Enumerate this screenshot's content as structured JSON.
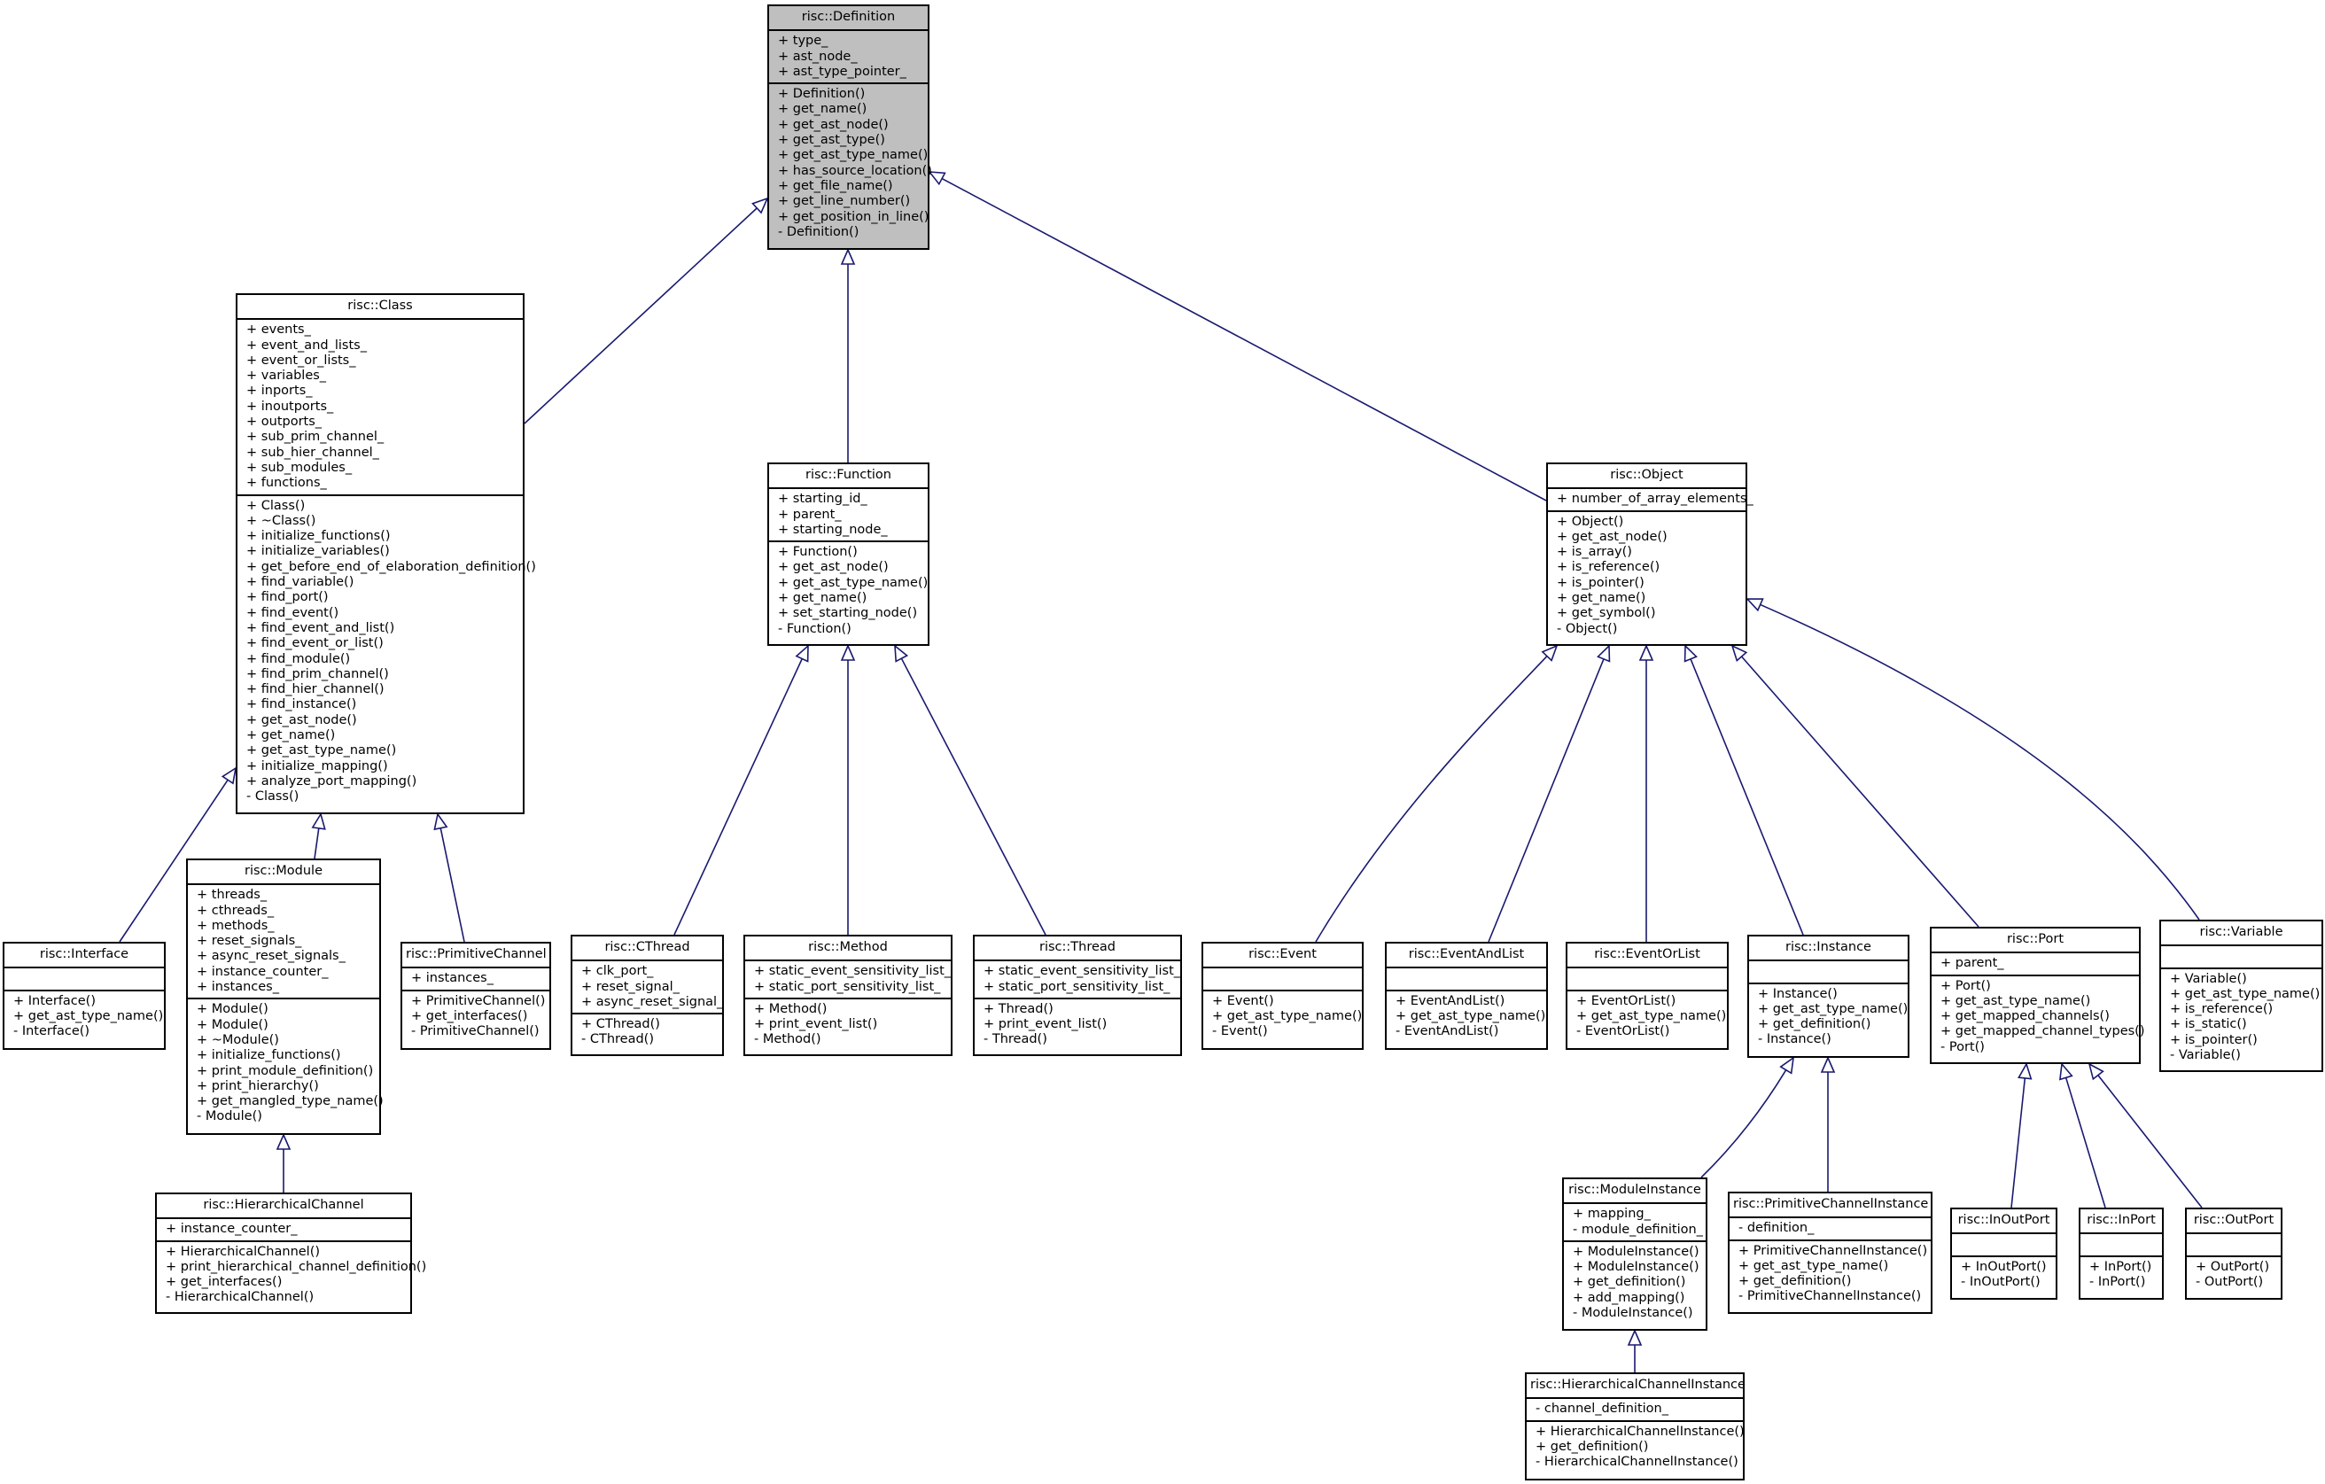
{
  "diagram": {
    "type": "uml-class-inheritance",
    "edge_color": "#191970",
    "root_fill": "#bfbfbf",
    "classes": [
      {
        "id": "Definition",
        "name": "risc::Definition",
        "root": true,
        "attributes": [
          "+ type_",
          "+ ast_node_",
          "+ ast_type_pointer_"
        ],
        "methods": [
          "+ Definition()",
          "+ get_name()",
          "+ get_ast_node()",
          "+ get_ast_type()",
          "+ get_ast_type_name()",
          "+ has_source_location()",
          "+ get_file_name()",
          "+ get_line_number()",
          "+ get_position_in_line()",
          "- Definition()"
        ]
      },
      {
        "id": "Class",
        "name": "risc::Class",
        "attributes": [
          "+ events_",
          "+ event_and_lists_",
          "+ event_or_lists_",
          "+ variables_",
          "+ inports_",
          "+ inoutports_",
          "+ outports_",
          "+ sub_prim_channel_",
          "+ sub_hier_channel_",
          "+ sub_modules_",
          "+ functions_"
        ],
        "methods": [
          "+ Class()",
          "+ ~Class()",
          "+ initialize_functions()",
          "+ initialize_variables()",
          "+ get_before_end_of_elaboration_definition()",
          "+ find_variable()",
          "+ find_port()",
          "+ find_event()",
          "+ find_event_and_list()",
          "+ find_event_or_list()",
          "+ find_module()",
          "+ find_prim_channel()",
          "+ find_hier_channel()",
          "+ find_instance()",
          "+ get_ast_node()",
          "+ get_name()",
          "+ get_ast_type_name()",
          "+ initialize_mapping()",
          "+ analyze_port_mapping()",
          "- Class()"
        ]
      },
      {
        "id": "Function",
        "name": "risc::Function",
        "attributes": [
          "+ starting_id_",
          "+ parent_",
          "+ starting_node_"
        ],
        "methods": [
          "+ Function()",
          "+ get_ast_node()",
          "+ get_ast_type_name()",
          "+ get_name()",
          "+ set_starting_node()",
          "- Function()"
        ]
      },
      {
        "id": "Object",
        "name": "risc::Object",
        "attributes": [
          "+ number_of_array_elements_"
        ],
        "methods": [
          "+ Object()",
          "+ get_ast_node()",
          "+ is_array()",
          "+ is_reference()",
          "+ is_pointer()",
          "+ get_name()",
          "+ get_symbol()",
          "- Object()"
        ]
      },
      {
        "id": "Interface",
        "name": "risc::Interface",
        "attributes": [],
        "methods": [
          "+ Interface()",
          "+ get_ast_type_name()",
          "- Interface()"
        ]
      },
      {
        "id": "Module",
        "name": "risc::Module",
        "attributes": [
          "+ threads_",
          "+ cthreads_",
          "+ methods_",
          "+ reset_signals_",
          "+ async_reset_signals_",
          "+ instance_counter_",
          "+ instances_"
        ],
        "methods": [
          "+ Module()",
          "+ Module()",
          "+ ~Module()",
          "+ initialize_functions()",
          "+ print_module_definition()",
          "+ print_hierarchy()",
          "+ get_mangled_type_name()",
          "- Module()"
        ]
      },
      {
        "id": "PrimitiveChannel",
        "name": "risc::PrimitiveChannel",
        "attributes": [
          "+ instances_"
        ],
        "methods": [
          "+ PrimitiveChannel()",
          "+ get_interfaces()",
          "- PrimitiveChannel()"
        ]
      },
      {
        "id": "HierarchicalChannel",
        "name": "risc::HierarchicalChannel",
        "attributes": [
          "+ instance_counter_"
        ],
        "methods": [
          "+ HierarchicalChannel()",
          "+ print_hierarchical_channel_definition()",
          "+ get_interfaces()",
          "- HierarchicalChannel()"
        ]
      },
      {
        "id": "CThread",
        "name": "risc::CThread",
        "attributes": [
          "+ clk_port_",
          "+ reset_signal_",
          "+ async_reset_signal_"
        ],
        "methods": [
          "+ CThread()",
          "- CThread()"
        ]
      },
      {
        "id": "Method",
        "name": "risc::Method",
        "attributes": [
          "+ static_event_sensitivity_list_",
          "+ static_port_sensitivity_list_"
        ],
        "methods": [
          "+ Method()",
          "+ print_event_list()",
          "- Method()"
        ]
      },
      {
        "id": "Thread",
        "name": "risc::Thread",
        "attributes": [
          "+ static_event_sensitivity_list_",
          "+ static_port_sensitivity_list_"
        ],
        "methods": [
          "+ Thread()",
          "+ print_event_list()",
          "- Thread()"
        ]
      },
      {
        "id": "Event",
        "name": "risc::Event",
        "attributes": [],
        "methods": [
          "+ Event()",
          "+ get_ast_type_name()",
          "- Event()"
        ]
      },
      {
        "id": "EventAndList",
        "name": "risc::EventAndList",
        "attributes": [],
        "methods": [
          "+ EventAndList()",
          "+ get_ast_type_name()",
          "- EventAndList()"
        ]
      },
      {
        "id": "EventOrList",
        "name": "risc::EventOrList",
        "attributes": [],
        "methods": [
          "+ EventOrList()",
          "+ get_ast_type_name()",
          "- EventOrList()"
        ]
      },
      {
        "id": "Instance",
        "name": "risc::Instance",
        "attributes": [],
        "methods": [
          "+ Instance()",
          "+ get_ast_type_name()",
          "+ get_definition()",
          "- Instance()"
        ]
      },
      {
        "id": "Port",
        "name": "risc::Port",
        "attributes": [
          "+ parent_"
        ],
        "methods": [
          "+ Port()",
          "+ get_ast_type_name()",
          "+ get_mapped_channels()",
          "+ get_mapped_channel_types()",
          "- Port()"
        ]
      },
      {
        "id": "Variable",
        "name": "risc::Variable",
        "attributes": [],
        "methods": [
          "+ Variable()",
          "+ get_ast_type_name()",
          "+ is_reference()",
          "+ is_static()",
          "+ is_pointer()",
          "- Variable()"
        ]
      },
      {
        "id": "ModuleInstance",
        "name": "risc::ModuleInstance",
        "attributes": [
          "+ mapping_",
          "- module_definition_"
        ],
        "methods": [
          "+ ModuleInstance()",
          "+ ModuleInstance()",
          "+ get_definition()",
          "+ add_mapping()",
          "- ModuleInstance()"
        ]
      },
      {
        "id": "PrimitiveChannelInstance",
        "name": "risc::PrimitiveChannelInstance",
        "attributes": [
          "- definition_"
        ],
        "methods": [
          "+ PrimitiveChannelInstance()",
          "+ get_ast_type_name()",
          "+ get_definition()",
          "- PrimitiveChannelInstance()"
        ]
      },
      {
        "id": "InOutPort",
        "name": "risc::InOutPort",
        "attributes": [],
        "methods": [
          "+ InOutPort()",
          "- InOutPort()"
        ]
      },
      {
        "id": "InPort",
        "name": "risc::InPort",
        "attributes": [],
        "methods": [
          "+ InPort()",
          "- InPort()"
        ]
      },
      {
        "id": "OutPort",
        "name": "risc::OutPort",
        "attributes": [],
        "methods": [
          "+ OutPort()",
          "- OutPort()"
        ]
      },
      {
        "id": "HierarchicalChannelInstance",
        "name": "risc::HierarchicalChannelInstance",
        "attributes": [
          "- channel_definition_"
        ],
        "methods": [
          "+ HierarchicalChannelInstance()",
          "+ get_definition()",
          "- HierarchicalChannelInstance()"
        ]
      }
    ],
    "inheritance": [
      {
        "child": "Class",
        "parent": "Definition"
      },
      {
        "child": "Function",
        "parent": "Definition"
      },
      {
        "child": "Object",
        "parent": "Definition"
      },
      {
        "child": "Interface",
        "parent": "Class"
      },
      {
        "child": "Module",
        "parent": "Class"
      },
      {
        "child": "PrimitiveChannel",
        "parent": "Class"
      },
      {
        "child": "HierarchicalChannel",
        "parent": "Module"
      },
      {
        "child": "CThread",
        "parent": "Function"
      },
      {
        "child": "Method",
        "parent": "Function"
      },
      {
        "child": "Thread",
        "parent": "Function"
      },
      {
        "child": "Event",
        "parent": "Object"
      },
      {
        "child": "EventAndList",
        "parent": "Object"
      },
      {
        "child": "EventOrList",
        "parent": "Object"
      },
      {
        "child": "Instance",
        "parent": "Object"
      },
      {
        "child": "Port",
        "parent": "Object"
      },
      {
        "child": "Variable",
        "parent": "Object"
      },
      {
        "child": "ModuleInstance",
        "parent": "Instance"
      },
      {
        "child": "PrimitiveChannelInstance",
        "parent": "Instance"
      },
      {
        "child": "HierarchicalChannelInstance",
        "parent": "ModuleInstance"
      },
      {
        "child": "InOutPort",
        "parent": "Port"
      },
      {
        "child": "InPort",
        "parent": "Port"
      },
      {
        "child": "OutPort",
        "parent": "Port"
      }
    ]
  }
}
